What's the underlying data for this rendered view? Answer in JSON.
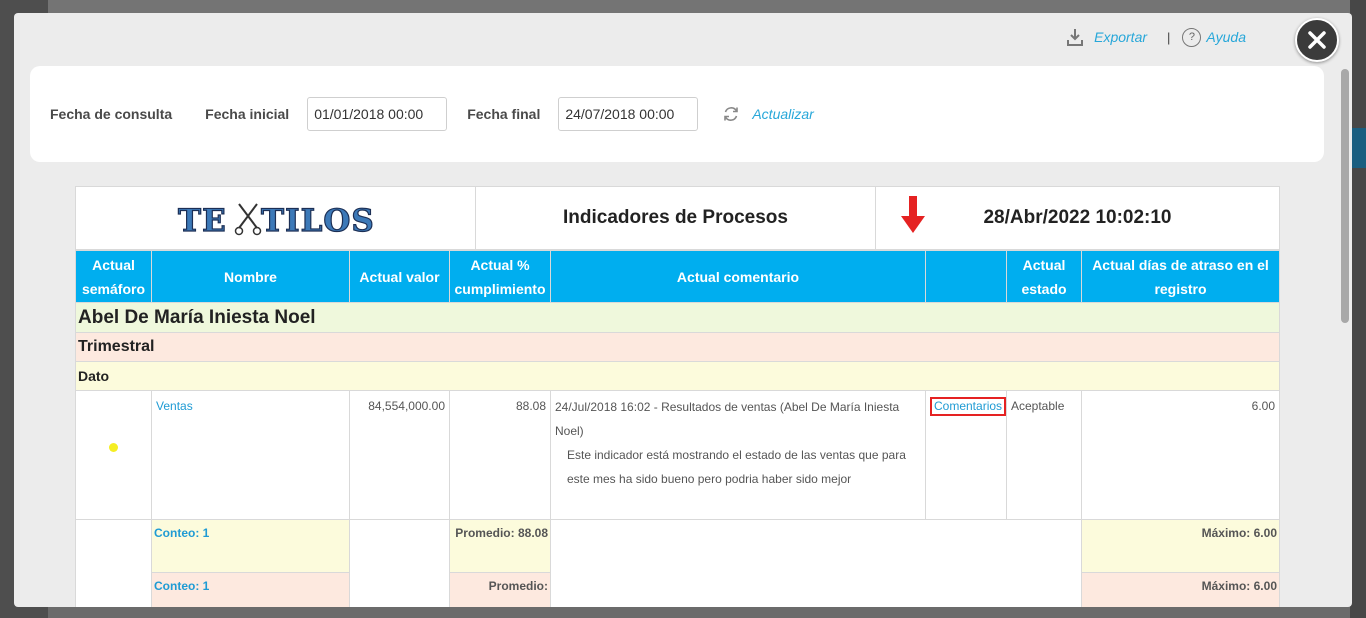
{
  "topbar": {
    "export_label": "Exportar",
    "separator": "|",
    "help_label": "Ayuda",
    "help_glyph": "?"
  },
  "filters": {
    "query_label": "Fecha de consulta",
    "start_label": "Fecha inicial",
    "start_value": "01/01/2018 00:00",
    "end_label": "Fecha final",
    "end_value": "24/07/2018 00:00",
    "refresh_label": "Actualizar"
  },
  "report": {
    "logo_text": "TEXTILOS",
    "title": "Indicadores de Procesos",
    "datetime": "28/Abr/2022 10:02:10",
    "columns": [
      "Actual semáforo",
      "Nombre",
      "Actual valor",
      "Actual % cumplimiento",
      "Actual comentario",
      "",
      "Actual estado",
      "Actual días de atraso en el registro"
    ],
    "group_person": "Abel De María Iniesta Noel",
    "group_period": "Trimestral",
    "group_type": "Dato",
    "row": {
      "name": "Ventas",
      "value": "84,554,000.00",
      "compliance": "88.08",
      "comment_line1": "24/Jul/2018 16:02 - Resultados de ventas (Abel De María Iniesta Noel)",
      "comment_line2": "Este indicador está mostrando el estado de las ventas que para este mes ha sido bueno pero podria haber sido mejor",
      "comments_link": "Comentarios",
      "state": "Aceptable",
      "days_late": "6.00"
    },
    "summary1": {
      "count": "Conteo: 1",
      "avg": "Promedio: 88.08",
      "max": "Máximo: 6.00"
    },
    "summary2": {
      "count": "Conteo: 1",
      "avg": "Promedio:",
      "max": "Máximo: 6.00"
    }
  },
  "colors": {
    "header_blue": "#00aeef",
    "link_blue": "#1f9bd4",
    "traffic_light": "#f5ee23",
    "highlight_red": "#e52222"
  },
  "icons": [
    "download-icon",
    "help-icon",
    "close-icon",
    "refresh-icon",
    "scissors-icon",
    "down-arrow-icon"
  ]
}
